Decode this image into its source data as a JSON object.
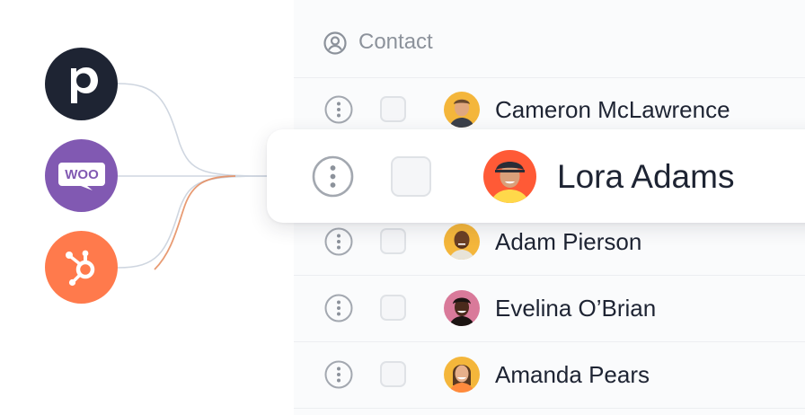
{
  "integrations": [
    {
      "name": "pipedrive",
      "glyph": "p",
      "color": "#1e2433"
    },
    {
      "name": "woocommerce",
      "glyph": "Woo",
      "color": "#8159b2"
    },
    {
      "name": "hubspot",
      "color": "#ff7a4c"
    }
  ],
  "table": {
    "header_label": "Contact",
    "header_icon": "user-circle-icon",
    "rows": [
      {
        "name": "Cameron McLawrence",
        "avatar_bg": "#f4b63b"
      },
      {
        "name": "Adam Pierson",
        "avatar_bg": "#f4b63b"
      },
      {
        "name": "Evelina O’Brian",
        "avatar_bg": "#d97a9a"
      },
      {
        "name": "Amanda Pears",
        "avatar_bg": "#f4b63b"
      }
    ],
    "highlighted": {
      "name": "Lora Adams",
      "avatar_bg": "#ff5a36"
    }
  }
}
